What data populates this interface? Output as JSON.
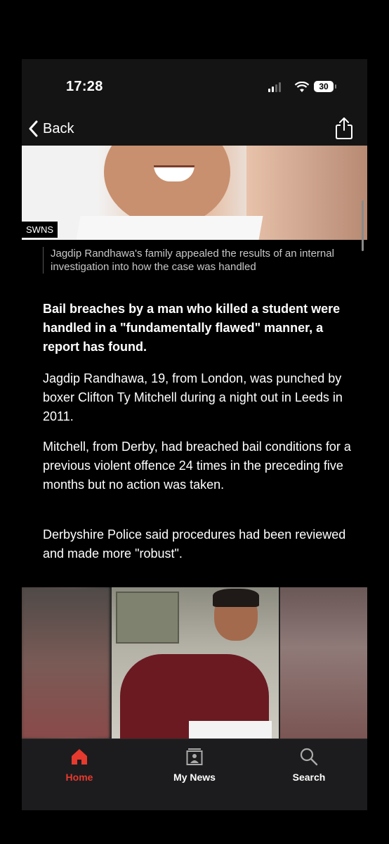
{
  "status_bar": {
    "time": "17:28",
    "battery": "30"
  },
  "nav": {
    "back_label": "Back"
  },
  "article": {
    "hero_credit": "SWNS",
    "caption": "Jagdip Randhawa's family appealed the results of an internal investigation into how the case was handled",
    "paragraphs": [
      "Bail breaches by a man who killed a student were handled in a \"fundamentally flawed\" manner, a report has found.",
      "Jagdip Randhawa, 19, from London, was punched by boxer Clifton Ty Mitchell during a night out in Leeds in 2011.",
      "Mitchell, from Derby, had breached bail conditions for a previous violent offence 24 times in the preceding five months but no action was taken.",
      "Derbyshire Police said procedures had been reviewed and made more \"robust\"."
    ]
  },
  "tab_bar": {
    "home": "Home",
    "my_news": "My News",
    "search": "Search",
    "active_color": "#e63a2e"
  }
}
